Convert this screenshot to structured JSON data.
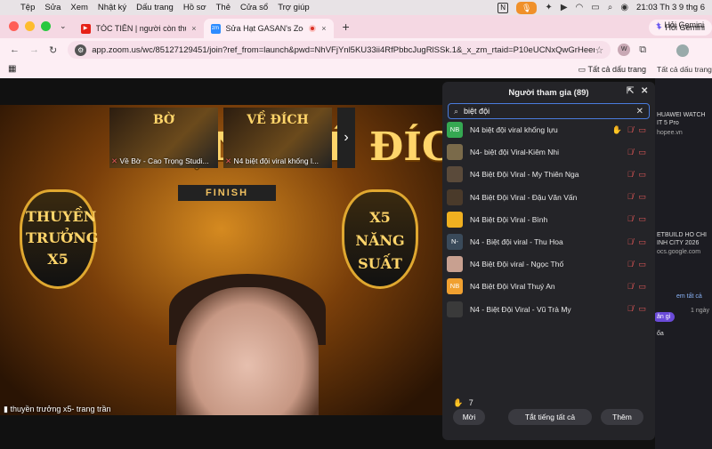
{
  "menubar": {
    "items": [
      "Tệp",
      "Sửa",
      "Xem",
      "Nhật ký",
      "Dấu trang",
      "Hồ sơ",
      "Thẻ",
      "Cửa sổ",
      "Trợ giúp"
    ],
    "clock": "21:03 Th 3 9 thg 6"
  },
  "tabs": [
    {
      "title": "TÓC TIÊN | người còn thương...",
      "close": "×"
    },
    {
      "title": "Sửa Hạt GASAN's Zoom M...",
      "close": "×"
    }
  ],
  "new_tab": "+",
  "gemini": {
    "label": "Hỏi Gemini",
    "label2": "Hỏi Gemini"
  },
  "address": {
    "url": "app.zoom.us/wc/85127129451/join?ref_from=launch&pwd=NhVFjYnl5KU33ii4RfPbbcJugRlSSk.1&_x_zm_rtaid=P10eUCNxQwGrHeerVsF5VA...",
    "ext_avatar": "W"
  },
  "bookmarks": {
    "all_label": "Tất cả dấu trang"
  },
  "second_window": {
    "bookmarks": "Tất cả dấu trang",
    "snippets": [
      "HUAWEI WATCH",
      "IT 5 Pro",
      "hopee.vn",
      "ETBUILD HO CHI",
      "INH CITY 2026",
      "ocs.google.com",
      "em tất cả",
      "1 ngày",
      "ăn gì",
      "ổa"
    ]
  },
  "meeting": {
    "stage_texts": {
      "title": "CHẶNG VỀ ĐÍCH",
      "finish": "FINISH",
      "left_shield": "THUYỀN TRƯỞNG X5",
      "right_shield": "X5 NĂNG SUẤT"
    },
    "speaker_name": "thuyền trưởng x5- trang trần",
    "videos": [
      {
        "caption": "Về Bờ - Cao Trọng Studi...",
        "badge": "BỜ"
      },
      {
        "caption": "N4 biệt đội viral khống l...",
        "badge": "VỀ ĐÍCH"
      }
    ],
    "strip_next": "›"
  },
  "participants": {
    "title": "Người tham gia (89)",
    "search_value": "biệt đội",
    "raised_count": "7",
    "list": [
      {
        "initials": "NB",
        "name": "N4 biệt đội viral khống lựu",
        "color": "#35a852",
        "hand": true
      },
      {
        "initials": "",
        "name": "N4- biệt đội Viral-Kiêm Nhi",
        "color": "#7a6a4a",
        "hand": false
      },
      {
        "initials": "",
        "name": "N4 Biệt Đội Viral - My Thiên Nga",
        "color": "#5a4a3a",
        "hand": false
      },
      {
        "initials": "",
        "name": "N4 Biệt Đội Viral - Đậu Văn Vấn",
        "color": "#4a3a2a",
        "hand": false
      },
      {
        "initials": "",
        "name": "N4 Biệt Đội Viral - Bình",
        "color": "#f0b020",
        "hand": false
      },
      {
        "initials": "N-",
        "name": "N4 - Biệt đội viral - Thu Hoa",
        "color": "#3a4a5a",
        "hand": false
      },
      {
        "initials": "",
        "name": "N4 Biệt Đội viral - Ngọc Thố",
        "color": "#c8a090",
        "hand": false
      },
      {
        "initials": "NB",
        "name": "N4 Biệt Đội Viral Thuý An",
        "color": "#f0a030",
        "hand": false
      },
      {
        "initials": "",
        "name": "N4 - Biệt Đội Viral - Vũ Trà My",
        "color": "#3a3a3a",
        "hand": false
      }
    ],
    "buttons": {
      "invite": "Mời",
      "mute_all": "Tắt tiếng tất cả",
      "more": "Thêm"
    }
  },
  "colors": {
    "accent": "#4a7cdd",
    "mic_off": "#e25858",
    "panel_bg": "#242428"
  }
}
